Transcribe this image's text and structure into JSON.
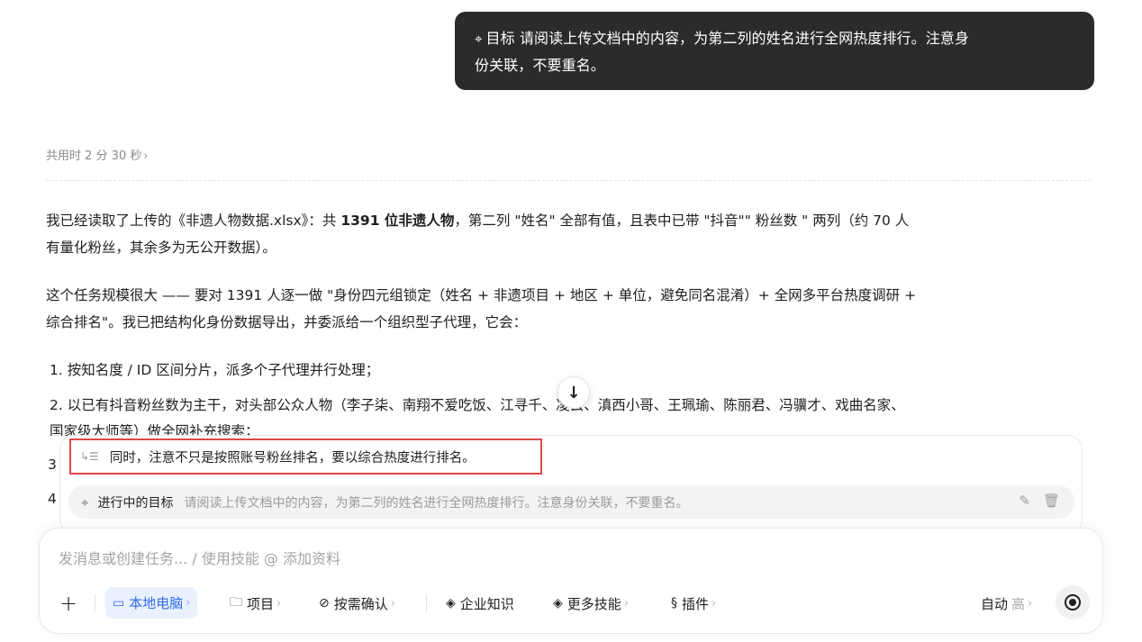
{
  "goal_bubble": {
    "icon": "target-icon",
    "label": "目标",
    "text_line1": "请阅读上传文档中的内容，为第二列的姓名进行全网热度排行。注意身",
    "text_line2": "份关联，不要重名。"
  },
  "elapsed": {
    "text": "共用时 2 分 30 秒",
    "chevron": "›"
  },
  "paragraph1": {
    "before": "我已经读取了上传的《非遗人物数据.xlsx》：共 ",
    "bold": "1391 位非遗人物",
    "after_line1": "，第二列 \"姓名\" 全部有值，且表中已带 \"抖音\"\" 粉丝数 \" 两列（约 70 人",
    "line2": "有量化粉丝，其余多为无公开数据）。"
  },
  "paragraph2": {
    "line1": "这个任务规模很大 —— 要对 1391 人逐一做 \"身份四元组锁定（姓名 + 非遗项目 + 地区 + 单位，避免同名混淆）+ 全网多平台热度调研 +",
    "line2": "综合排名\"。我已把结构化身份数据导出，并委派给一个组织型子代理，它会："
  },
  "list": {
    "item1": "1. 按知名度 / ID 区间分片，派多个子代理并行处理；",
    "item2": "2. 以已有抖音粉丝数为主干，对头部公众人物（李子柒、南翔不爱吃饭、江寻千、凌云、滇西小哥、王珮瑜、陈丽君、冯骥才、戏曲名家、",
    "item2_cont": "国家级大师等）做全网补充搜索；",
    "num3": "3",
    "num4": "4"
  },
  "queue": {
    "pending_message": "同时，注意不只是按照账号粉丝排名，要以综合热度进行排名。",
    "goal_label": "进行中的目标",
    "goal_text": "请阅读上传文档中的内容，为第二列的姓名进行全网热度排行。注意身份关联，不要重名。"
  },
  "composer": {
    "placeholder": "发消息或创建任务... / 使用技能 @ 添加资料",
    "local_pc": "本地电脑",
    "project": "项目",
    "confirm": "按需确认",
    "knowledge": "企业知识",
    "more_skills": "更多技能",
    "plugins": "插件",
    "auto": "自动",
    "level": "高",
    "chevron": "›"
  }
}
